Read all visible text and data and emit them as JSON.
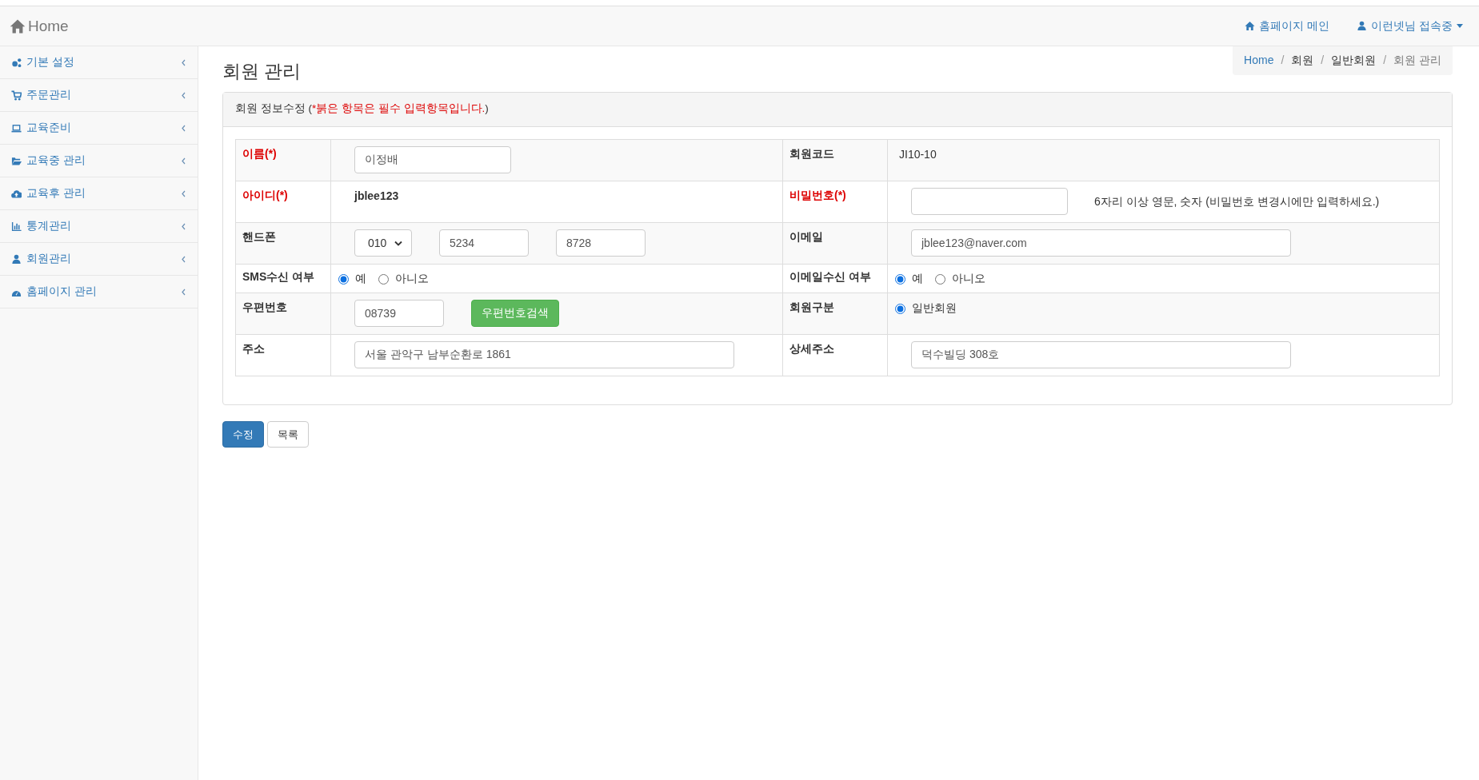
{
  "navbar": {
    "brand": "Home",
    "links": [
      {
        "kind": "home",
        "label": "홈페이지 메인",
        "dropdown": false
      },
      {
        "kind": "user",
        "label": "이런넷님 접속중",
        "dropdown": true
      }
    ]
  },
  "sidebar": {
    "items": [
      {
        "kind": "gears",
        "label": "기본 설정",
        "expanded": false
      },
      {
        "kind": "cart",
        "label": "주문관리",
        "expanded": false
      },
      {
        "kind": "laptop",
        "label": "교육준비",
        "expanded": false
      },
      {
        "kind": "folder",
        "label": "교육중 관리",
        "expanded": false
      },
      {
        "kind": "cloud",
        "label": "교육후 관리",
        "expanded": false
      },
      {
        "kind": "chart",
        "label": "통계관리",
        "expanded": false
      },
      {
        "kind": "user",
        "label": "회원관리",
        "expanded": false
      },
      {
        "kind": "gauge",
        "label": "홈페이지 관리",
        "expanded": false
      }
    ]
  },
  "page": {
    "title": "회원 관리",
    "breadcrumb": [
      {
        "kind": "link",
        "label": "Home"
      },
      {
        "kind": "text",
        "separator": "/",
        "label": "회원"
      },
      {
        "kind": "text",
        "separator": "/",
        "label": "일반회원"
      },
      {
        "kind": "current",
        "separator": "/",
        "label": "회원 관리"
      }
    ]
  },
  "panel": {
    "heading": [
      {
        "text": "회원 정보수정 (",
        "required": false
      },
      {
        "text": "*붉은 항목은 필수 입력항목입니다.",
        "required": true
      },
      {
        "text": ")",
        "required": false
      }
    ],
    "rows": [
      {
        "left": {
          "label": "이름(*)",
          "required": true,
          "kind": "input",
          "value": "이정배"
        },
        "right": {
          "label": "회원코드",
          "required": false,
          "kind": "static",
          "value": "JI10-10",
          "bold": false
        }
      },
      {
        "left": {
          "label": "아이디(*)",
          "required": true,
          "kind": "static",
          "value": "jblee123",
          "bold": true
        },
        "right": {
          "label": "비밀번호(*)",
          "required": true,
          "kind": "password",
          "hint": "6자리 이상 영문, 숫자 (비밀번호 변경시에만 입력하세요.)"
        }
      },
      {
        "left": {
          "label": "핸드폰",
          "required": false,
          "kind": "phone",
          "prefix": "010",
          "parts": [
            "5234",
            "8728"
          ]
        },
        "right": {
          "label": "이메일",
          "required": false,
          "kind": "wide-input",
          "value": "jblee123@naver.com"
        }
      },
      {
        "left": {
          "label": "SMS수신 여부",
          "required": false,
          "kind": "radio",
          "options": [
            {
              "label": "예",
              "selected": true
            },
            {
              "label": "아니오",
              "selected": false
            }
          ]
        },
        "right": {
          "label": "이메일수신 여부",
          "required": false,
          "kind": "radio",
          "options": [
            {
              "label": "예",
              "selected": true
            },
            {
              "label": "아니오",
              "selected": false
            }
          ]
        }
      },
      {
        "left": {
          "label": "우편번호",
          "required": false,
          "kind": "zip",
          "value": "08739",
          "button": "우편번호검색"
        },
        "right": {
          "label": "회원구분",
          "required": false,
          "kind": "radio",
          "options": [
            {
              "label": "일반회원",
              "selected": true
            }
          ]
        }
      },
      {
        "left": {
          "label": "주소",
          "required": false,
          "kind": "wide-input",
          "value": "서울 관악구 남부순환로 1861"
        },
        "right": {
          "label": "상세주소",
          "required": false,
          "kind": "wide-input",
          "value": "덕수빌딩 308호"
        }
      }
    ]
  },
  "actions": [
    {
      "kind": "primary",
      "label": "수정"
    },
    {
      "kind": "default",
      "label": "목록"
    }
  ]
}
